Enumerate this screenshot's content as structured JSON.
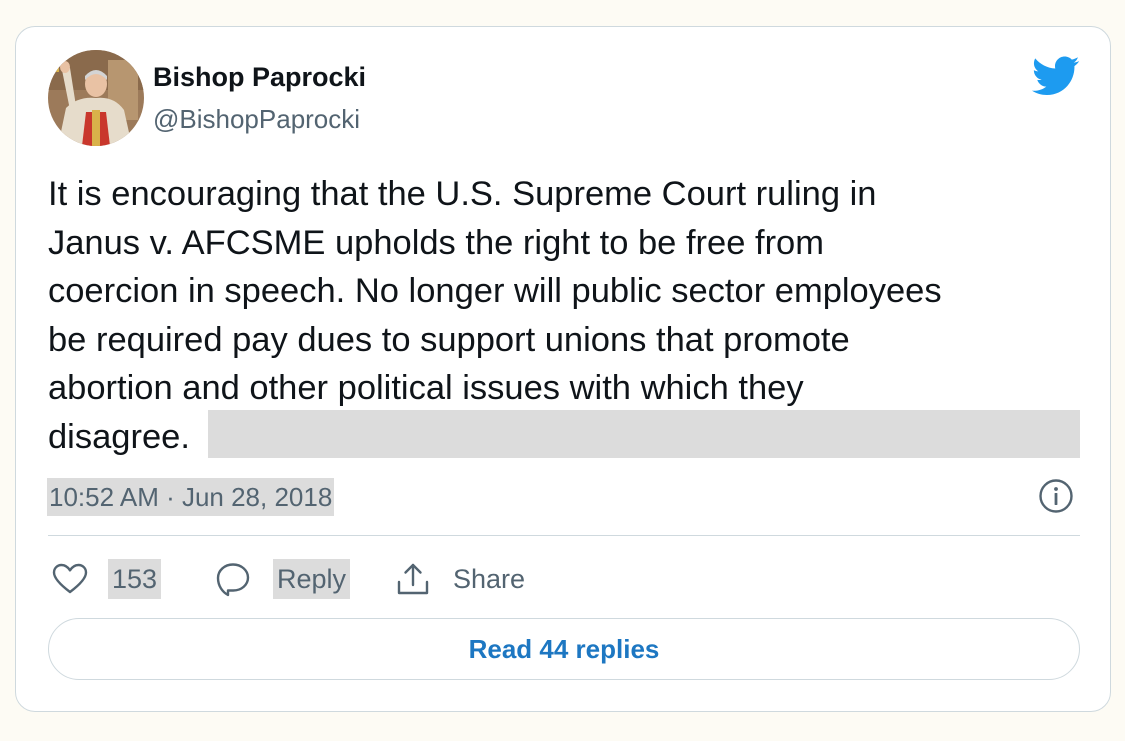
{
  "author": {
    "display_name": "Bishop Paprocki",
    "handle": "@BishopPaprocki",
    "avatar_icon": "avatar-photo"
  },
  "brand": {
    "icon": "twitter-bird-icon",
    "color": "#1d9bf0"
  },
  "tweet": {
    "lines": [
      "It is encouraging that the U.S. Supreme Court ruling in",
      "Janus v. AFCSME upholds the right to be free from",
      "coercion in speech. No longer will public sector employees",
      "be required pay dues to support unions that promote",
      "abortion and other political issues with which they",
      "disagree."
    ],
    "timestamp": "10:52 AM · Jun 28, 2018"
  },
  "actions": {
    "like": {
      "icon": "heart-icon",
      "count": "153"
    },
    "reply": {
      "icon": "speech-bubble-icon",
      "label": "Reply"
    },
    "share": {
      "icon": "share-upload-icon",
      "label": "Share"
    },
    "info_icon": "info-icon"
  },
  "read_replies_label": "Read 44 replies",
  "colors": {
    "text_primary": "#0f1419",
    "text_secondary": "#536471",
    "link": "#1d77c2",
    "highlight": "#dcdcdc",
    "border": "#cfd9de"
  }
}
